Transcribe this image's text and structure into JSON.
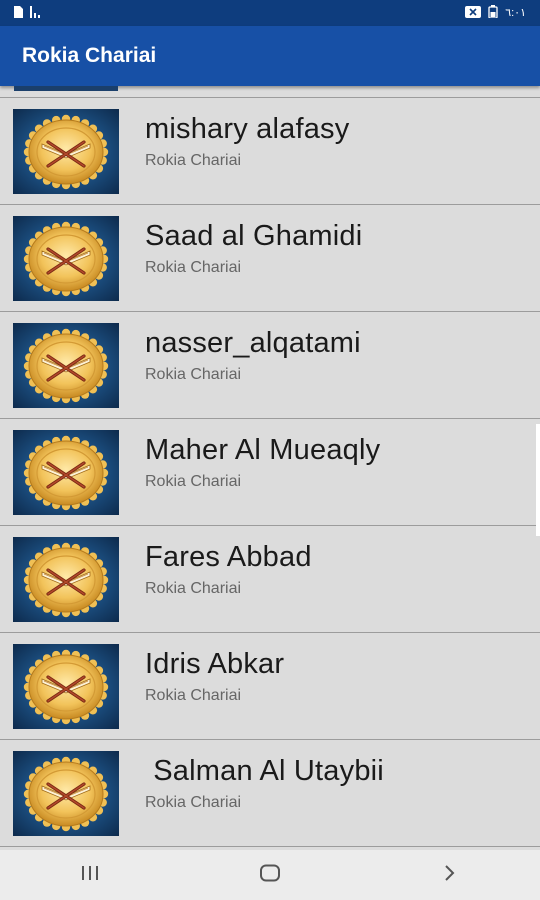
{
  "status_bar": {
    "time": "٦:٠١",
    "icons_left": [
      "sim-icon",
      "signal-icon"
    ],
    "icons_right": [
      "notification-icon",
      "battery-icon"
    ]
  },
  "app_bar": {
    "title": "Rokia Chariai"
  },
  "list": {
    "items": [
      {
        "title": "mishary alafasy",
        "subtitle": "Rokia Chariai",
        "icon": "quran-icon"
      },
      {
        "title": "Saad al Ghamidi",
        "subtitle": "Rokia Chariai",
        "icon": "quran-icon"
      },
      {
        "title": "nasser_alqatami",
        "subtitle": "Rokia Chariai",
        "icon": "quran-icon"
      },
      {
        "title": "Maher Al Mueaqly",
        "subtitle": "Rokia Chariai",
        "icon": "quran-icon"
      },
      {
        "title": "Fares Abbad",
        "subtitle": "Rokia Chariai",
        "icon": "quran-icon"
      },
      {
        "title": "Idris Abkar",
        "subtitle": "Rokia Chariai",
        "icon": "quran-icon"
      },
      {
        "title": " Salman Al Utaybii",
        "subtitle": "Rokia Chariai",
        "icon": "quran-icon"
      }
    ]
  },
  "nav_bar": {
    "buttons": [
      "recent-apps-icon",
      "home-icon",
      "back-icon"
    ]
  },
  "colors": {
    "status_bar": "#0e3d7e",
    "app_bar": "#1750a6",
    "list_background": "#dcdcdc",
    "divider": "#9c9c9c"
  }
}
